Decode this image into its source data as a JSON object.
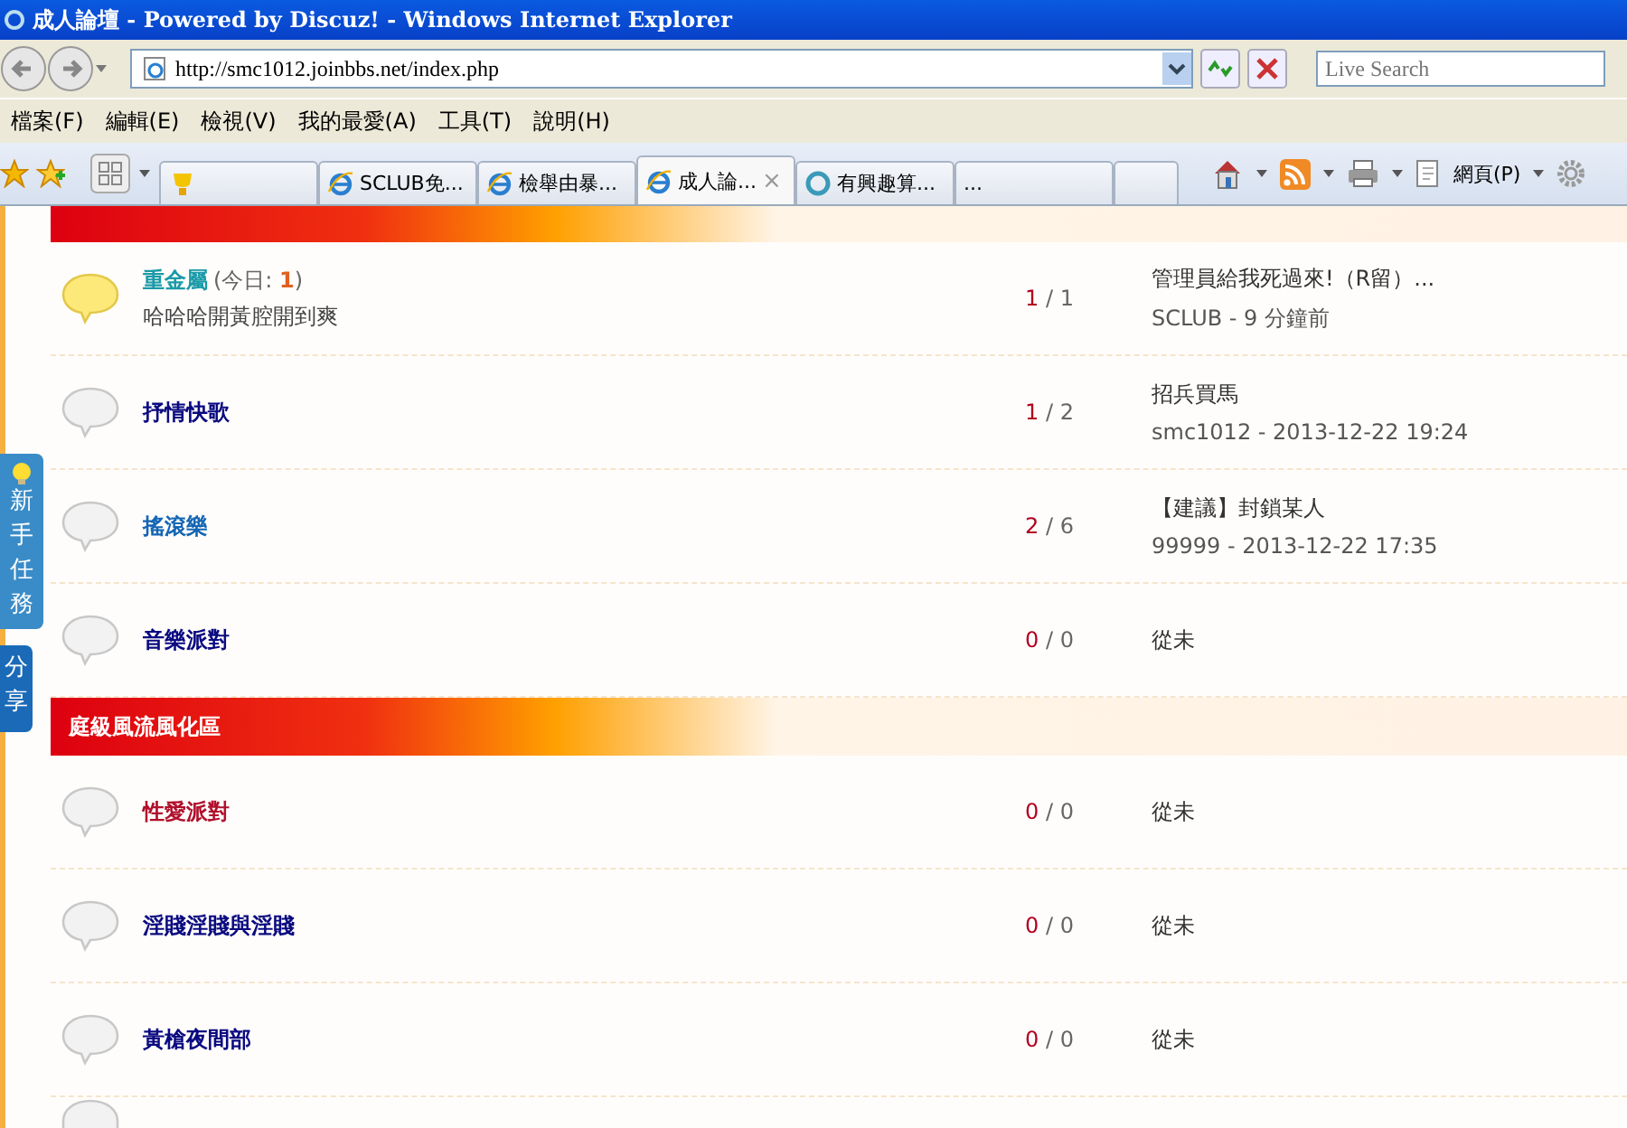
{
  "window": {
    "title": "成人論壇 - Powered by Discuz! - Windows Internet Explorer"
  },
  "address_bar": {
    "url": "http://smc1012.joinbbs.net/index.php"
  },
  "search": {
    "placeholder": "Live Search"
  },
  "menu": [
    "檔案(F)",
    "編輯(E)",
    "檢視(V)",
    "我的最愛(A)",
    "工具(T)",
    "說明(H)"
  ],
  "tabs": [
    {
      "kind": "trophy",
      "selected": false
    },
    {
      "kind": "ie",
      "label": "SCLUB免...",
      "selected": false
    },
    {
      "kind": "ie",
      "label": "檢舉由暴...",
      "selected": false
    },
    {
      "kind": "ie",
      "label": "成人論...",
      "close": "×",
      "selected": true
    },
    {
      "kind": "ring",
      "label": "有興趣算...",
      "selected": false
    },
    {
      "kind": "blank",
      "label": "...",
      "selected": false
    },
    {
      "kind": "new",
      "selected": false
    }
  ],
  "command_bar": {
    "page_menu": "網頁(P)"
  },
  "side_tabs": [
    {
      "label": "新手任務"
    },
    {
      "label": "分享"
    }
  ],
  "sections": [
    {
      "forums": [
        {
          "name": "重金屬",
          "color": "#1a9aa8",
          "new": true,
          "today_label": "(今日: ",
          "today": "1",
          "today_end": ")",
          "description": "哈哈哈開黃腔開到爽",
          "counts": "*1* / 1",
          "last_title": "管理員給我死過來!（R留）...",
          "last_by": "SCLUB - 9 分鐘前"
        },
        {
          "name": "抒情快歌",
          "color": "#0a0a80",
          "new": false,
          "counts": "*1* / 2",
          "last_title": "招兵買馬",
          "last_by": "smc1012 - 2013-12-22 19:24"
        },
        {
          "name": "搖滾樂",
          "color": "#1466b4",
          "new": false,
          "counts": "*2* / 6",
          "last_title": "【建議】封鎖某人",
          "last_by": "99999 - 2013-12-22 17:35"
        },
        {
          "name": "音樂派對",
          "color": "#0a0a80",
          "new": false,
          "counts": "*0* / 0",
          "last_none": "從未"
        }
      ]
    },
    {
      "title": "庭級風流風化區",
      "forums": [
        {
          "name": "性愛派對",
          "color": "#b0102c",
          "new": false,
          "counts": "*0* / 0",
          "last_none": "從未"
        },
        {
          "name": "淫賤淫賤與淫賤",
          "color": "#0a0a80",
          "new": false,
          "counts": "*0* / 0",
          "last_none": "從未"
        },
        {
          "name": "黃槍夜間部",
          "color": "#0a0a80",
          "new": false,
          "counts": "*0* / 0",
          "last_none": "從未"
        }
      ]
    }
  ]
}
